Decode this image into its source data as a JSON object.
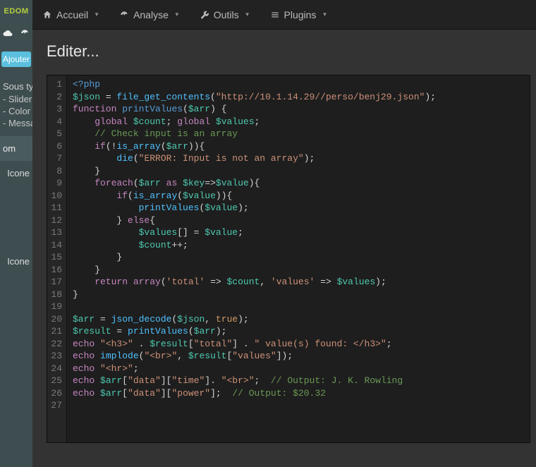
{
  "brand": "EDOM",
  "topnav": [
    {
      "label": "Accueil",
      "icon": "home"
    },
    {
      "label": "Analyse",
      "icon": "dash"
    },
    {
      "label": "Outils",
      "icon": "wrench"
    },
    {
      "label": "Plugins",
      "icon": "list"
    }
  ],
  "left": {
    "add_button": "Ajouter",
    "heading1": "Sous ty",
    "items1": [
      "- Slider",
      "- Color",
      "- Messa"
    ],
    "block": "om",
    "icone_label": "Icone"
  },
  "editor_title": "Editer...",
  "code_lines": [
    [
      {
        "c": "tok-tag",
        "t": "<?php"
      }
    ],
    [
      {
        "c": "tok-var",
        "t": "$json"
      },
      {
        "c": "tok-op",
        "t": " = "
      },
      {
        "c": "tok-call",
        "t": "file_get_contents"
      },
      {
        "c": "tok-punc",
        "t": "("
      },
      {
        "c": "tok-str",
        "t": "\"http://10.1.14.29//perso/benj29.json\""
      },
      {
        "c": "tok-punc",
        "t": ");"
      }
    ],
    [
      {
        "c": "tok-kw",
        "t": "function"
      },
      {
        "c": "",
        "t": " "
      },
      {
        "c": "tok-fn",
        "t": "printValues"
      },
      {
        "c": "tok-punc",
        "t": "("
      },
      {
        "c": "tok-var",
        "t": "$arr"
      },
      {
        "c": "tok-punc",
        "t": ") {"
      }
    ],
    [
      {
        "c": "",
        "t": "    "
      },
      {
        "c": "tok-kw",
        "t": "global"
      },
      {
        "c": "",
        "t": " "
      },
      {
        "c": "tok-var",
        "t": "$count"
      },
      {
        "c": "tok-punc",
        "t": "; "
      },
      {
        "c": "tok-kw",
        "t": "global"
      },
      {
        "c": "",
        "t": " "
      },
      {
        "c": "tok-var",
        "t": "$values"
      },
      {
        "c": "tok-punc",
        "t": ";"
      }
    ],
    [
      {
        "c": "",
        "t": "    "
      },
      {
        "c": "tok-cmt",
        "t": "// Check input is an array"
      }
    ],
    [
      {
        "c": "",
        "t": "    "
      },
      {
        "c": "tok-kw",
        "t": "if"
      },
      {
        "c": "tok-punc",
        "t": "(!"
      },
      {
        "c": "tok-call",
        "t": "is_array"
      },
      {
        "c": "tok-punc",
        "t": "("
      },
      {
        "c": "tok-var",
        "t": "$arr"
      },
      {
        "c": "tok-punc",
        "t": ")){"
      }
    ],
    [
      {
        "c": "",
        "t": "        "
      },
      {
        "c": "tok-call",
        "t": "die"
      },
      {
        "c": "tok-punc",
        "t": "("
      },
      {
        "c": "tok-str",
        "t": "\"ERROR: Input is not an array\""
      },
      {
        "c": "tok-punc",
        "t": ");"
      }
    ],
    [
      {
        "c": "",
        "t": "    "
      },
      {
        "c": "tok-punc",
        "t": "}"
      }
    ],
    [
      {
        "c": "",
        "t": "    "
      },
      {
        "c": "tok-kw",
        "t": "foreach"
      },
      {
        "c": "tok-punc",
        "t": "("
      },
      {
        "c": "tok-var",
        "t": "$arr"
      },
      {
        "c": "",
        "t": " "
      },
      {
        "c": "tok-kw",
        "t": "as"
      },
      {
        "c": "",
        "t": " "
      },
      {
        "c": "tok-var",
        "t": "$key"
      },
      {
        "c": "tok-op",
        "t": "=>"
      },
      {
        "c": "tok-var",
        "t": "$value"
      },
      {
        "c": "tok-punc",
        "t": "){"
      }
    ],
    [
      {
        "c": "",
        "t": "        "
      },
      {
        "c": "tok-kw",
        "t": "if"
      },
      {
        "c": "tok-punc",
        "t": "("
      },
      {
        "c": "tok-call",
        "t": "is_array"
      },
      {
        "c": "tok-punc",
        "t": "("
      },
      {
        "c": "tok-var",
        "t": "$value"
      },
      {
        "c": "tok-punc",
        "t": ")){"
      }
    ],
    [
      {
        "c": "",
        "t": "            "
      },
      {
        "c": "tok-call",
        "t": "printValues"
      },
      {
        "c": "tok-punc",
        "t": "("
      },
      {
        "c": "tok-var",
        "t": "$value"
      },
      {
        "c": "tok-punc",
        "t": ");"
      }
    ],
    [
      {
        "c": "",
        "t": "        "
      },
      {
        "c": "tok-punc",
        "t": "} "
      },
      {
        "c": "tok-kw",
        "t": "else"
      },
      {
        "c": "tok-punc",
        "t": "{"
      }
    ],
    [
      {
        "c": "",
        "t": "            "
      },
      {
        "c": "tok-var",
        "t": "$values"
      },
      {
        "c": "tok-punc",
        "t": "[] = "
      },
      {
        "c": "tok-var",
        "t": "$value"
      },
      {
        "c": "tok-punc",
        "t": ";"
      }
    ],
    [
      {
        "c": "",
        "t": "            "
      },
      {
        "c": "tok-var",
        "t": "$count"
      },
      {
        "c": "tok-op",
        "t": "++"
      },
      {
        "c": "tok-punc",
        "t": ";"
      }
    ],
    [
      {
        "c": "",
        "t": "        "
      },
      {
        "c": "tok-punc",
        "t": "}"
      }
    ],
    [
      {
        "c": "",
        "t": "    "
      },
      {
        "c": "tok-punc",
        "t": "}"
      }
    ],
    [
      {
        "c": "",
        "t": "    "
      },
      {
        "c": "tok-kw",
        "t": "return"
      },
      {
        "c": "",
        "t": " "
      },
      {
        "c": "tok-kw",
        "t": "array"
      },
      {
        "c": "tok-punc",
        "t": "("
      },
      {
        "c": "tok-str",
        "t": "'total'"
      },
      {
        "c": "tok-op",
        "t": " => "
      },
      {
        "c": "tok-var",
        "t": "$count"
      },
      {
        "c": "tok-punc",
        "t": ", "
      },
      {
        "c": "tok-str",
        "t": "'values'"
      },
      {
        "c": "tok-op",
        "t": " => "
      },
      {
        "c": "tok-var",
        "t": "$values"
      },
      {
        "c": "tok-punc",
        "t": ");"
      }
    ],
    [
      {
        "c": "tok-punc",
        "t": "}"
      }
    ],
    [
      {
        "c": "",
        "t": ""
      }
    ],
    [
      {
        "c": "tok-var",
        "t": "$arr"
      },
      {
        "c": "tok-op",
        "t": " = "
      },
      {
        "c": "tok-call",
        "t": "json_decode"
      },
      {
        "c": "tok-punc",
        "t": "("
      },
      {
        "c": "tok-var",
        "t": "$json"
      },
      {
        "c": "tok-punc",
        "t": ", "
      },
      {
        "c": "tok-bool",
        "t": "true"
      },
      {
        "c": "tok-punc",
        "t": ");"
      }
    ],
    [
      {
        "c": "tok-var",
        "t": "$result"
      },
      {
        "c": "tok-op",
        "t": " = "
      },
      {
        "c": "tok-call",
        "t": "printValues"
      },
      {
        "c": "tok-punc",
        "t": "("
      },
      {
        "c": "tok-var",
        "t": "$arr"
      },
      {
        "c": "tok-punc",
        "t": ");"
      }
    ],
    [
      {
        "c": "tok-kw",
        "t": "echo"
      },
      {
        "c": "",
        "t": " "
      },
      {
        "c": "tok-str",
        "t": "\"<h3>\""
      },
      {
        "c": "tok-op",
        "t": " . "
      },
      {
        "c": "tok-var",
        "t": "$result"
      },
      {
        "c": "tok-punc",
        "t": "["
      },
      {
        "c": "tok-str",
        "t": "\"total\""
      },
      {
        "c": "tok-punc",
        "t": "]"
      },
      {
        "c": "tok-op",
        "t": " . "
      },
      {
        "c": "tok-str",
        "t": "\" value(s) found: </h3>\""
      },
      {
        "c": "tok-punc",
        "t": ";"
      }
    ],
    [
      {
        "c": "tok-kw",
        "t": "echo"
      },
      {
        "c": "",
        "t": " "
      },
      {
        "c": "tok-call",
        "t": "implode"
      },
      {
        "c": "tok-punc",
        "t": "("
      },
      {
        "c": "tok-str",
        "t": "\"<br>\""
      },
      {
        "c": "tok-punc",
        "t": ", "
      },
      {
        "c": "tok-var",
        "t": "$result"
      },
      {
        "c": "tok-punc",
        "t": "["
      },
      {
        "c": "tok-str",
        "t": "\"values\""
      },
      {
        "c": "tok-punc",
        "t": "]);"
      }
    ],
    [
      {
        "c": "tok-kw",
        "t": "echo"
      },
      {
        "c": "",
        "t": " "
      },
      {
        "c": "tok-str",
        "t": "\"<hr>\""
      },
      {
        "c": "tok-punc",
        "t": ";"
      }
    ],
    [
      {
        "c": "tok-kw",
        "t": "echo"
      },
      {
        "c": "",
        "t": " "
      },
      {
        "c": "tok-var",
        "t": "$arr"
      },
      {
        "c": "tok-punc",
        "t": "["
      },
      {
        "c": "tok-str",
        "t": "\"data\""
      },
      {
        "c": "tok-punc",
        "t": "]["
      },
      {
        "c": "tok-str",
        "t": "\"time\""
      },
      {
        "c": "tok-punc",
        "t": "]. "
      },
      {
        "c": "tok-str",
        "t": "\"<br>\""
      },
      {
        "c": "tok-punc",
        "t": ";  "
      },
      {
        "c": "tok-cmt",
        "t": "// Output: J. K. Rowling"
      }
    ],
    [
      {
        "c": "tok-kw",
        "t": "echo"
      },
      {
        "c": "",
        "t": " "
      },
      {
        "c": "tok-var",
        "t": "$arr"
      },
      {
        "c": "tok-punc",
        "t": "["
      },
      {
        "c": "tok-str",
        "t": "\"data\""
      },
      {
        "c": "tok-punc",
        "t": "]["
      },
      {
        "c": "tok-str",
        "t": "\"power\""
      },
      {
        "c": "tok-punc",
        "t": "];  "
      },
      {
        "c": "tok-cmt",
        "t": "// Output: $20.32"
      }
    ],
    [
      {
        "c": "",
        "t": ""
      }
    ]
  ]
}
